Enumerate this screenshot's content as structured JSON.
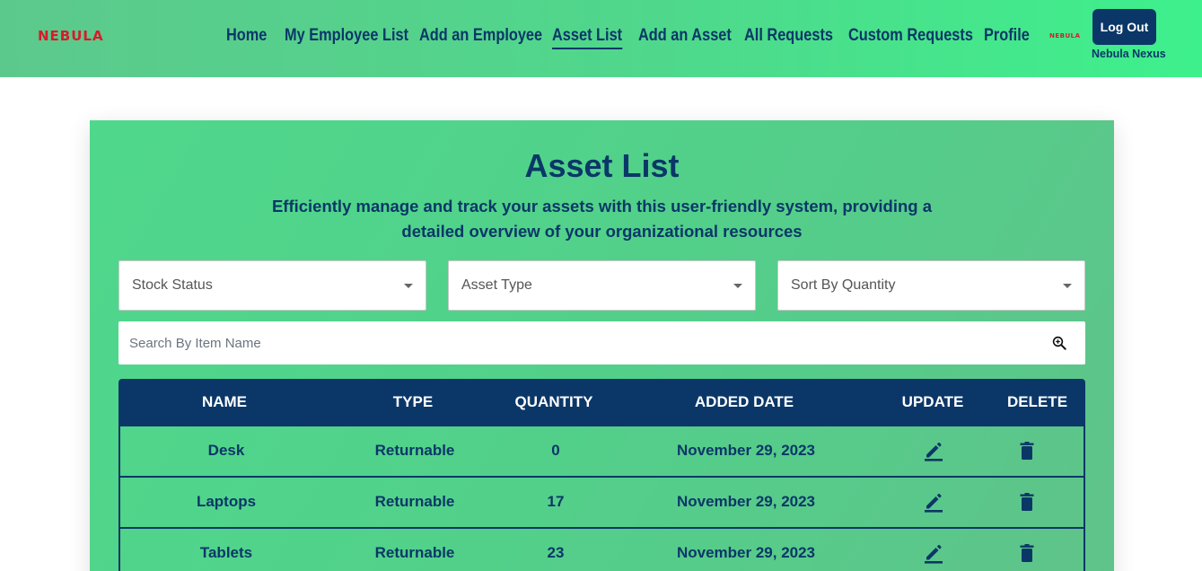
{
  "brand": {
    "logo": "NEBULA",
    "mini_logo": "NEBULA"
  },
  "nav": {
    "items": [
      {
        "label": "Home"
      },
      {
        "label": "My Employee List"
      },
      {
        "label": "Add an Employee"
      },
      {
        "label": "Asset List",
        "active": true
      },
      {
        "label": "Add an Asset"
      },
      {
        "label": "All Requests"
      },
      {
        "label": "Custom Requests"
      },
      {
        "label": "Profile"
      }
    ],
    "logout_label": "Log Out",
    "user_name": "Nebula Nexus"
  },
  "page": {
    "title": "Asset List",
    "subtitle": "Efficiently manage and track your assets with this user-friendly system, providing a detailed overview of your organizational resources"
  },
  "filters": {
    "stock_status": "Stock Status",
    "asset_type": "Asset Type",
    "sort_by_quantity": "Sort By Quantity"
  },
  "search": {
    "placeholder": "Search By Item Name"
  },
  "table": {
    "headers": [
      "NAME",
      "TYPE",
      "QUANTITY",
      "ADDED DATE",
      "UPDATE",
      "DELETE"
    ],
    "rows": [
      {
        "name": "Desk",
        "type": "Returnable",
        "quantity": "0",
        "date": "November 29, 2023"
      },
      {
        "name": "Laptops",
        "type": "Returnable",
        "quantity": "17",
        "date": "November 29, 2023"
      },
      {
        "name": "Tablets",
        "type": "Returnable",
        "quantity": "23",
        "date": "November 29, 2023"
      }
    ]
  },
  "colors": {
    "primary": "#0b3768",
    "accent_green": "#4fd88c",
    "logo_red": "#d81b2a"
  },
  "icons": {
    "search": "search-icon",
    "update": "edit-icon",
    "delete": "trash-icon"
  }
}
